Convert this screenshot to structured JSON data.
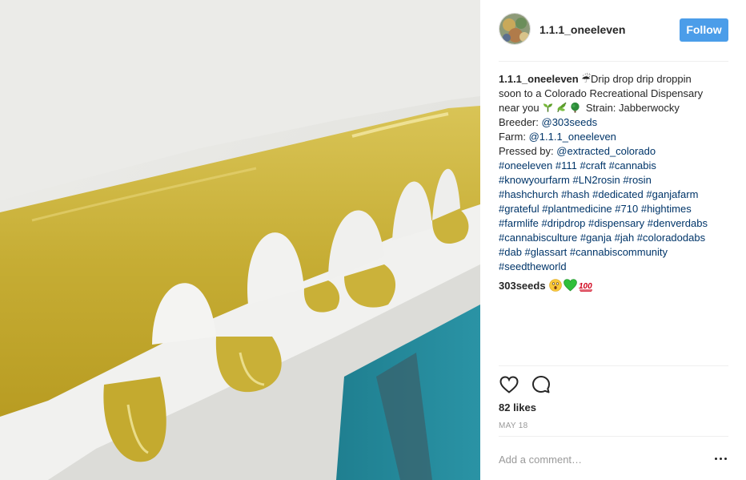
{
  "post": {
    "username": "1.1.1_oneeleven",
    "follow_label": "Follow",
    "caption": {
      "user": "1.1.1_oneeleven",
      "l1": "☔Drip drop drip droppin",
      "l2": "soon to a Colorado Recreational Dispensary",
      "l3_a": "near you",
      "l3_b": "Strain: Jabberwocky",
      "l4_label": "Breeder:",
      "l4_link": "@303seeds",
      "l5_label": "Farm:",
      "l5_link": "@1.1.1_oneeleven",
      "l6_label": "Pressed by:",
      "l6_link": "@extracted_colorado",
      "hashtag_lines": [
        [
          "#oneeleven",
          "#111",
          "#craft",
          "#cannabis"
        ],
        [
          "#knowyourfarm",
          "#LN2rosin",
          "#rosin"
        ],
        [
          "#hashchurch",
          "#hash",
          "#dedicated",
          "#ganjafarm"
        ],
        [
          "#grateful",
          "#plantmedicine",
          "#710",
          "#hightimes"
        ],
        [
          "#farmlife",
          "#dripdrop",
          "#dispensary",
          "#denverdabs"
        ],
        [
          "#cannabisculture",
          "#ganja",
          "#jah",
          "#coloradodabs"
        ],
        [
          "#dab",
          "#glassart",
          "#cannabiscommunity"
        ],
        [
          "#seedtheworld"
        ]
      ]
    },
    "comment": {
      "user": "303seeds",
      "emojis": [
        "astonished-face-emoji",
        "green-heart-emoji",
        "hundred-points-emoji"
      ]
    },
    "likes": "82 likes",
    "date": "MAY 18",
    "add_comment_placeholder": "Add a comment…",
    "icons": {
      "like": "heart-outline-icon",
      "comment": "speech-bubble-icon",
      "more": "ellipsis-icon"
    },
    "colors": {
      "follow_button": "#4b9de9",
      "link": "#003569",
      "resin": "#c8b33a"
    }
  }
}
